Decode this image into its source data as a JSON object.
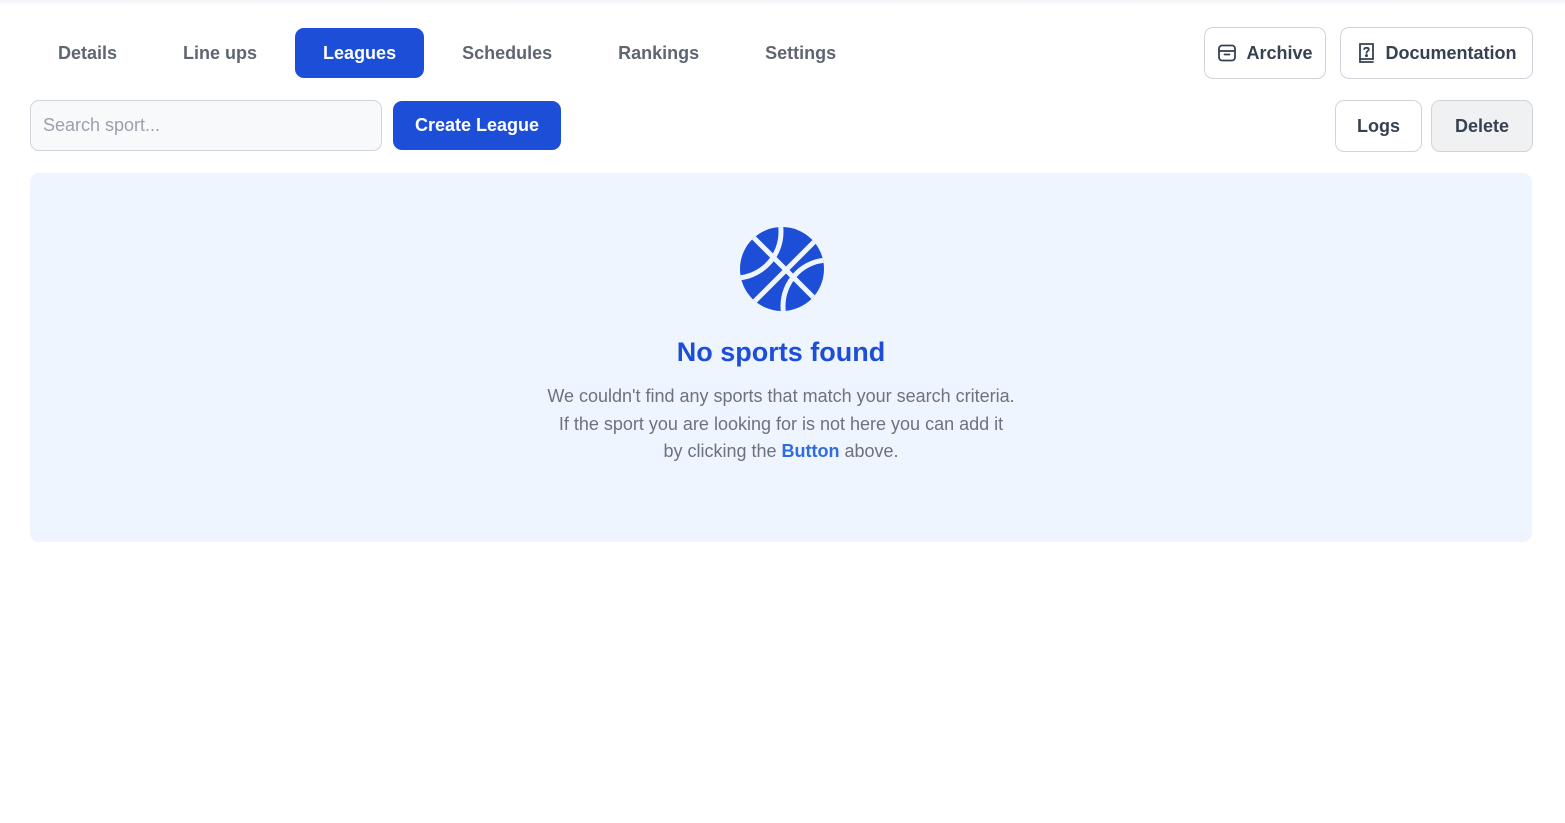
{
  "tabs": [
    {
      "label": "Details",
      "active": false
    },
    {
      "label": "Line ups",
      "active": false
    },
    {
      "label": "Leagues",
      "active": true
    },
    {
      "label": "Schedules",
      "active": false
    },
    {
      "label": "Rankings",
      "active": false
    },
    {
      "label": "Settings",
      "active": false
    }
  ],
  "header_actions": {
    "archive_label": "Archive",
    "archive_icon": "archive-box-icon",
    "documentation_label": "Documentation",
    "documentation_icon": "question-book-icon"
  },
  "toolbar": {
    "search_placeholder": "Search sport...",
    "search_value": "",
    "create_label": "Create League",
    "logs_label": "Logs",
    "delete_label": "Delete"
  },
  "empty_state": {
    "icon": "basketball-icon",
    "title": "No sports found",
    "line1": "We couldn't find any sports that match your search criteria.",
    "line2": "If the sport you are looking for is not here you can add it",
    "line3_before": "by clicking the ",
    "line3_link": "Button",
    "line3_after": " above."
  },
  "colors": {
    "primary": "#1d4ed8",
    "panel_bg": "#eef5fe",
    "muted_text": "#6b7280",
    "link": "#2f6ce0"
  }
}
